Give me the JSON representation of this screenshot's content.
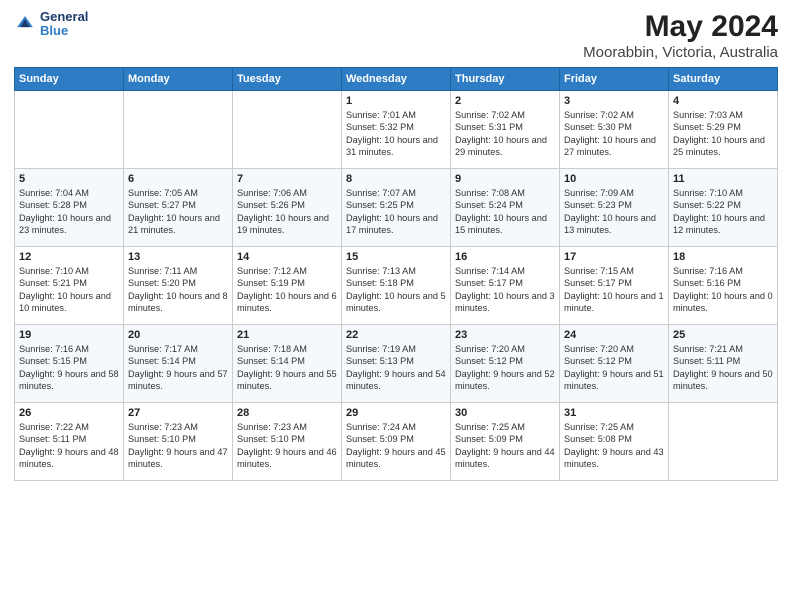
{
  "header": {
    "logo_line1": "General",
    "logo_line2": "Blue",
    "title": "May 2024",
    "subtitle": "Moorabbin, Victoria, Australia"
  },
  "weekdays": [
    "Sunday",
    "Monday",
    "Tuesday",
    "Wednesday",
    "Thursday",
    "Friday",
    "Saturday"
  ],
  "weeks": [
    [
      {
        "day": "",
        "sunrise": "",
        "sunset": "",
        "daylight": ""
      },
      {
        "day": "",
        "sunrise": "",
        "sunset": "",
        "daylight": ""
      },
      {
        "day": "",
        "sunrise": "",
        "sunset": "",
        "daylight": ""
      },
      {
        "day": "1",
        "sunrise": "Sunrise: 7:01 AM",
        "sunset": "Sunset: 5:32 PM",
        "daylight": "Daylight: 10 hours and 31 minutes."
      },
      {
        "day": "2",
        "sunrise": "Sunrise: 7:02 AM",
        "sunset": "Sunset: 5:31 PM",
        "daylight": "Daylight: 10 hours and 29 minutes."
      },
      {
        "day": "3",
        "sunrise": "Sunrise: 7:02 AM",
        "sunset": "Sunset: 5:30 PM",
        "daylight": "Daylight: 10 hours and 27 minutes."
      },
      {
        "day": "4",
        "sunrise": "Sunrise: 7:03 AM",
        "sunset": "Sunset: 5:29 PM",
        "daylight": "Daylight: 10 hours and 25 minutes."
      }
    ],
    [
      {
        "day": "5",
        "sunrise": "Sunrise: 7:04 AM",
        "sunset": "Sunset: 5:28 PM",
        "daylight": "Daylight: 10 hours and 23 minutes."
      },
      {
        "day": "6",
        "sunrise": "Sunrise: 7:05 AM",
        "sunset": "Sunset: 5:27 PM",
        "daylight": "Daylight: 10 hours and 21 minutes."
      },
      {
        "day": "7",
        "sunrise": "Sunrise: 7:06 AM",
        "sunset": "Sunset: 5:26 PM",
        "daylight": "Daylight: 10 hours and 19 minutes."
      },
      {
        "day": "8",
        "sunrise": "Sunrise: 7:07 AM",
        "sunset": "Sunset: 5:25 PM",
        "daylight": "Daylight: 10 hours and 17 minutes."
      },
      {
        "day": "9",
        "sunrise": "Sunrise: 7:08 AM",
        "sunset": "Sunset: 5:24 PM",
        "daylight": "Daylight: 10 hours and 15 minutes."
      },
      {
        "day": "10",
        "sunrise": "Sunrise: 7:09 AM",
        "sunset": "Sunset: 5:23 PM",
        "daylight": "Daylight: 10 hours and 13 minutes."
      },
      {
        "day": "11",
        "sunrise": "Sunrise: 7:10 AM",
        "sunset": "Sunset: 5:22 PM",
        "daylight": "Daylight: 10 hours and 12 minutes."
      }
    ],
    [
      {
        "day": "12",
        "sunrise": "Sunrise: 7:10 AM",
        "sunset": "Sunset: 5:21 PM",
        "daylight": "Daylight: 10 hours and 10 minutes."
      },
      {
        "day": "13",
        "sunrise": "Sunrise: 7:11 AM",
        "sunset": "Sunset: 5:20 PM",
        "daylight": "Daylight: 10 hours and 8 minutes."
      },
      {
        "day": "14",
        "sunrise": "Sunrise: 7:12 AM",
        "sunset": "Sunset: 5:19 PM",
        "daylight": "Daylight: 10 hours and 6 minutes."
      },
      {
        "day": "15",
        "sunrise": "Sunrise: 7:13 AM",
        "sunset": "Sunset: 5:18 PM",
        "daylight": "Daylight: 10 hours and 5 minutes."
      },
      {
        "day": "16",
        "sunrise": "Sunrise: 7:14 AM",
        "sunset": "Sunset: 5:17 PM",
        "daylight": "Daylight: 10 hours and 3 minutes."
      },
      {
        "day": "17",
        "sunrise": "Sunrise: 7:15 AM",
        "sunset": "Sunset: 5:17 PM",
        "daylight": "Daylight: 10 hours and 1 minute."
      },
      {
        "day": "18",
        "sunrise": "Sunrise: 7:16 AM",
        "sunset": "Sunset: 5:16 PM",
        "daylight": "Daylight: 10 hours and 0 minutes."
      }
    ],
    [
      {
        "day": "19",
        "sunrise": "Sunrise: 7:16 AM",
        "sunset": "Sunset: 5:15 PM",
        "daylight": "Daylight: 9 hours and 58 minutes."
      },
      {
        "day": "20",
        "sunrise": "Sunrise: 7:17 AM",
        "sunset": "Sunset: 5:14 PM",
        "daylight": "Daylight: 9 hours and 57 minutes."
      },
      {
        "day": "21",
        "sunrise": "Sunrise: 7:18 AM",
        "sunset": "Sunset: 5:14 PM",
        "daylight": "Daylight: 9 hours and 55 minutes."
      },
      {
        "day": "22",
        "sunrise": "Sunrise: 7:19 AM",
        "sunset": "Sunset: 5:13 PM",
        "daylight": "Daylight: 9 hours and 54 minutes."
      },
      {
        "day": "23",
        "sunrise": "Sunrise: 7:20 AM",
        "sunset": "Sunset: 5:12 PM",
        "daylight": "Daylight: 9 hours and 52 minutes."
      },
      {
        "day": "24",
        "sunrise": "Sunrise: 7:20 AM",
        "sunset": "Sunset: 5:12 PM",
        "daylight": "Daylight: 9 hours and 51 minutes."
      },
      {
        "day": "25",
        "sunrise": "Sunrise: 7:21 AM",
        "sunset": "Sunset: 5:11 PM",
        "daylight": "Daylight: 9 hours and 50 minutes."
      }
    ],
    [
      {
        "day": "26",
        "sunrise": "Sunrise: 7:22 AM",
        "sunset": "Sunset: 5:11 PM",
        "daylight": "Daylight: 9 hours and 48 minutes."
      },
      {
        "day": "27",
        "sunrise": "Sunrise: 7:23 AM",
        "sunset": "Sunset: 5:10 PM",
        "daylight": "Daylight: 9 hours and 47 minutes."
      },
      {
        "day": "28",
        "sunrise": "Sunrise: 7:23 AM",
        "sunset": "Sunset: 5:10 PM",
        "daylight": "Daylight: 9 hours and 46 minutes."
      },
      {
        "day": "29",
        "sunrise": "Sunrise: 7:24 AM",
        "sunset": "Sunset: 5:09 PM",
        "daylight": "Daylight: 9 hours and 45 minutes."
      },
      {
        "day": "30",
        "sunrise": "Sunrise: 7:25 AM",
        "sunset": "Sunset: 5:09 PM",
        "daylight": "Daylight: 9 hours and 44 minutes."
      },
      {
        "day": "31",
        "sunrise": "Sunrise: 7:25 AM",
        "sunset": "Sunset: 5:08 PM",
        "daylight": "Daylight: 9 hours and 43 minutes."
      },
      {
        "day": "",
        "sunrise": "",
        "sunset": "",
        "daylight": ""
      }
    ]
  ]
}
